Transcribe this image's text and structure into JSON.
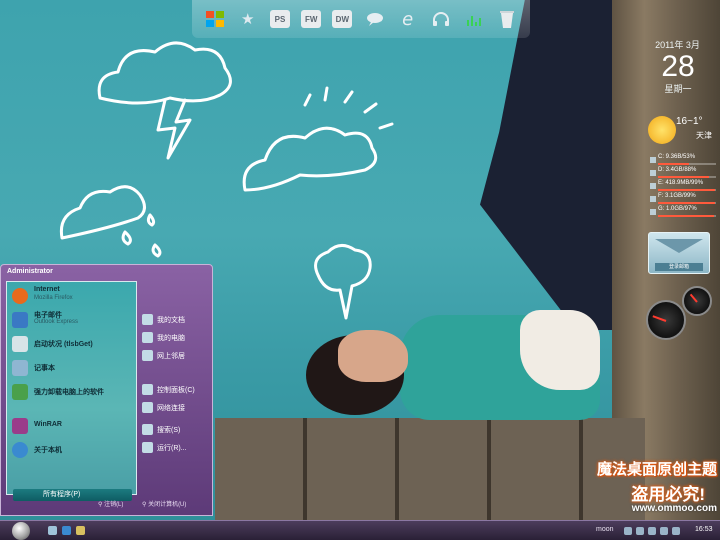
{
  "dock": {
    "items": [
      {
        "name": "windows-logo-icon"
      },
      {
        "name": "star-icon"
      },
      {
        "name": "photoshop-icon",
        "label": "PS"
      },
      {
        "name": "fireworks-icon",
        "label": "FW"
      },
      {
        "name": "dreamweaver-icon",
        "label": "DW"
      },
      {
        "name": "chat-bubble-icon"
      },
      {
        "name": "internet-explorer-icon"
      },
      {
        "name": "headphones-icon"
      },
      {
        "name": "equalizer-icon"
      },
      {
        "name": "recycle-bin-icon"
      }
    ]
  },
  "clock": {
    "date": "2011年 3月",
    "day": "28",
    "weekday": "星期一"
  },
  "weather": {
    "temp": "16~1°",
    "city": "天津",
    "condition_icon": "sun-cloud-icon"
  },
  "drives": [
    {
      "label": "C: 9.36B/53%",
      "percent": 53
    },
    {
      "label": "D: 3.4GB/88%",
      "percent": 88
    },
    {
      "label": "E: 418.9MB/99%",
      "percent": 99
    },
    {
      "label": "F: 3.1GB/99%",
      "percent": 99
    },
    {
      "label": "G: 1.0GB/97%",
      "percent": 97
    }
  ],
  "mail": {
    "button": "登录邮箱"
  },
  "start_menu": {
    "user": "Administrator",
    "left_items": [
      {
        "title": "Internet",
        "sub": "Mozilla Firefox",
        "icon": "firefox-icon",
        "color": "#e86a1c"
      },
      {
        "title": "电子邮件",
        "sub": "Outlook Express",
        "icon": "outlook-icon",
        "color": "#3a78c4"
      },
      {
        "title": "启动状况 (tlsbGet)",
        "sub": "",
        "icon": "app-icon",
        "color": "#d8e4e8"
      },
      {
        "title": "记事本",
        "sub": "",
        "icon": "notepad-icon",
        "color": "#8fb6d2"
      },
      {
        "title": "强力卸载电脑上的软件",
        "sub": "",
        "icon": "uninstall-icon",
        "color": "#4aa04a"
      },
      {
        "title": "WinRAR",
        "sub": "",
        "icon": "winrar-icon",
        "color": "#9a3c8a"
      },
      {
        "title": "关于本机",
        "sub": "",
        "icon": "globe-icon",
        "color": "#3a8ad0"
      }
    ],
    "all_programs": "所有程序(P)",
    "right_items": [
      {
        "label": "我的文档",
        "icon": "documents-icon"
      },
      {
        "label": "我的电脑",
        "icon": "computer-icon"
      },
      {
        "label": "网上邻居",
        "icon": "network-icon"
      },
      {
        "label": "控制面板(C)",
        "icon": "control-panel-icon"
      },
      {
        "label": "网络连接",
        "icon": "network-connections-icon"
      },
      {
        "label": "搜索(S)",
        "icon": "search-icon"
      },
      {
        "label": "运行(R)...",
        "icon": "run-icon"
      }
    ],
    "bottom": {
      "logoff": "注销(L)",
      "shutdown": "关闭计算机(U)"
    }
  },
  "brand": {
    "title": "魔法桌面原创主题",
    "slogan": "盗用必究!",
    "url": "www.ommoo.com"
  },
  "taskbar": {
    "lang": "moon",
    "time": "16:53"
  }
}
